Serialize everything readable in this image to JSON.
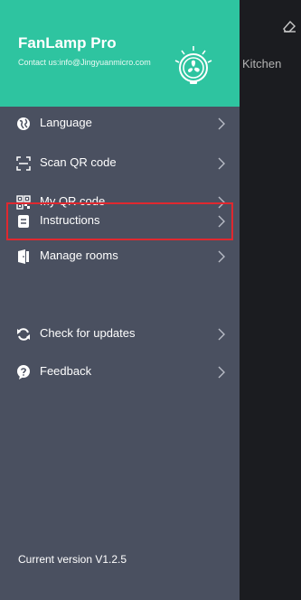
{
  "app": {
    "title": "FanLamp Pro",
    "contact": "Contact us:info@Jingyuanmicro.com"
  },
  "background": {
    "room_label": "Kitchen"
  },
  "menu": [
    {
      "label": "Language",
      "icon": "globe-icon"
    },
    {
      "label": "Scan QR code",
      "icon": "scan-icon"
    },
    {
      "label": "My QR code",
      "icon": "qr-code-icon"
    },
    {
      "label": "Manage rooms",
      "icon": "door-icon"
    },
    {
      "label": "Instructions",
      "icon": "document-icon"
    },
    {
      "label": "Check for updates",
      "icon": "refresh-icon"
    },
    {
      "label": "Feedback",
      "icon": "help-icon"
    }
  ],
  "version": "Current version V1.2.5",
  "colors": {
    "header": "#2ec4a0",
    "drawer": "#4a5060",
    "highlight": "#e0282f"
  }
}
